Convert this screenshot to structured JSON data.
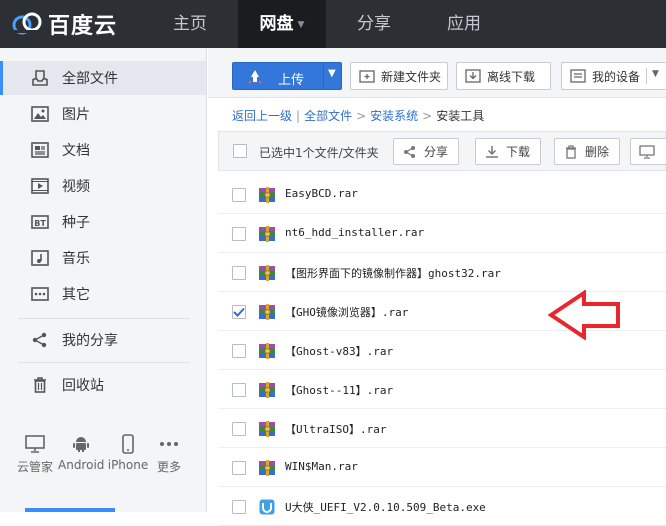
{
  "brand": {
    "name": "百度云"
  },
  "nav": [
    {
      "label": "主页"
    },
    {
      "label": "网盘",
      "active": true
    },
    {
      "label": "分享"
    },
    {
      "label": "应用"
    }
  ],
  "sidebar": {
    "items": [
      {
        "label": "全部文件",
        "icon": "file-tray-icon",
        "active": true
      },
      {
        "label": "图片",
        "icon": "image-icon"
      },
      {
        "label": "文档",
        "icon": "document-icon"
      },
      {
        "label": "视频",
        "icon": "video-icon"
      },
      {
        "label": "种子",
        "icon": "bt-icon"
      },
      {
        "label": "音乐",
        "icon": "music-icon"
      },
      {
        "label": "其它",
        "icon": "more-dots-icon"
      },
      {
        "label": "我的分享",
        "icon": "share-icon"
      },
      {
        "label": "回收站",
        "icon": "trash-icon"
      }
    ],
    "clients": [
      {
        "label": "云管家",
        "icon": "monitor-icon"
      },
      {
        "label": "Android",
        "icon": "android-icon"
      },
      {
        "label": "iPhone",
        "icon": "iphone-icon"
      },
      {
        "label": "更多",
        "icon": "ellipsis-icon"
      }
    ]
  },
  "toolbar": {
    "upload_label": "上传",
    "new_folder_label": "新建文件夹",
    "offline_download_label": "离线下载",
    "my_devices_label": "我的设备"
  },
  "breadcrumb": {
    "back": "返回上一级",
    "sep": "|",
    "items": [
      "全部文件",
      "安装系统",
      "安装工具"
    ],
    "arrow": ">"
  },
  "selection": {
    "text": "已选中1个文件/文件夹",
    "share_label": "分享",
    "download_label": "下载",
    "delete_label": "删除"
  },
  "files": [
    {
      "name": "EasyBCD.rar",
      "checked": false,
      "icon": "rar-icon"
    },
    {
      "name": "nt6_hdd_installer.rar",
      "checked": false,
      "icon": "rar-icon"
    },
    {
      "name": "【图形界面下的镜像制作器】ghost32.rar",
      "checked": false,
      "icon": "rar-icon"
    },
    {
      "name": "【GHO镜像浏览器】.rar",
      "checked": true,
      "icon": "rar-icon"
    },
    {
      "name": "【Ghost-v83】.rar",
      "checked": false,
      "icon": "rar-icon"
    },
    {
      "name": "【Ghost--11】.rar",
      "checked": false,
      "icon": "rar-icon"
    },
    {
      "name": "【UltraISO】.rar",
      "checked": false,
      "icon": "rar-icon"
    },
    {
      "name": "WIN$Man.rar",
      "checked": false,
      "icon": "rar-icon"
    },
    {
      "name": "U大侠_UEFI_V2.0.10.509_Beta.exe",
      "checked": false,
      "icon": "exe-icon"
    }
  ],
  "colors": {
    "topbar": "#2c2f34",
    "accent": "#3277d9",
    "annotation_arrow": "#e8262c"
  }
}
